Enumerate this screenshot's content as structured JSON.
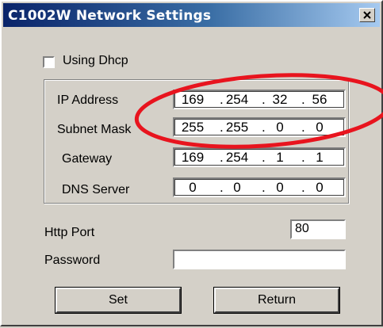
{
  "window": {
    "title": "C1002W Network Settings",
    "close_symbol": "×"
  },
  "dhcp": {
    "label": "Using Dhcp",
    "checked": false
  },
  "network": {
    "ip_address": {
      "label": "IP Address",
      "octets": [
        "169",
        "254",
        "32",
        "56"
      ]
    },
    "subnet_mask": {
      "label": "Subnet Mask",
      "octets": [
        "255",
        "255",
        "0",
        "0"
      ]
    },
    "gateway": {
      "label": "Gateway",
      "octets": [
        "169",
        "254",
        "1",
        "1"
      ]
    },
    "dns_server": {
      "label": "DNS Server",
      "octets": [
        "0",
        "0",
        "0",
        "0"
      ]
    }
  },
  "http_port": {
    "label": "Http Port",
    "value": "80"
  },
  "password": {
    "label": "Password",
    "value": ""
  },
  "buttons": {
    "set": "Set",
    "return": "Return"
  },
  "ip_dot": ".",
  "colors": {
    "titlebar_start": "#0a246a",
    "annotation_ellipse": "#e8141e"
  },
  "icons": {
    "close": "close-icon"
  }
}
